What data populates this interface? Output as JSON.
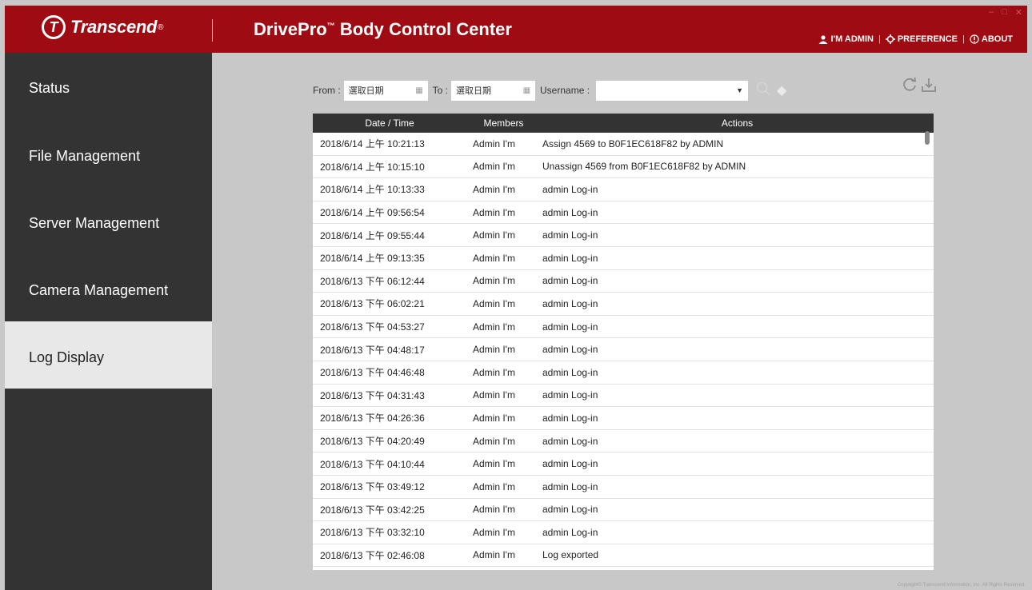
{
  "header": {
    "logo_text": "Transcend",
    "app_title": "DrivePro",
    "app_title_tm": "™",
    "app_title_rest": "Body Control Center",
    "links": {
      "user": "I'M ADMIN",
      "preference": "PREFERENCE",
      "about": "ABOUT"
    }
  },
  "sidebar": {
    "items": [
      {
        "label": "Status"
      },
      {
        "label": "File Management"
      },
      {
        "label": "Server Management"
      },
      {
        "label": "Camera Management"
      },
      {
        "label": "Log Display"
      }
    ]
  },
  "filters": {
    "from_label": "From :",
    "from_value": "選取日期",
    "to_label": "To :",
    "to_value": "選取日期",
    "username_label": "Username :",
    "username_value": ""
  },
  "table": {
    "headers": [
      "Date / Time",
      "Members",
      "Actions"
    ],
    "rows": [
      [
        "2018/6/14 上午 10:21:13",
        "Admin I'm",
        "Assign 4569 to B0F1EC618F82 by ADMIN"
      ],
      [
        "2018/6/14 上午 10:15:10",
        "Admin I'm",
        "Unassign 4569 from B0F1EC618F82 by ADMIN"
      ],
      [
        "2018/6/14 上午 10:13:33",
        "Admin I'm",
        "admin Log-in"
      ],
      [
        "2018/6/14 上午 09:56:54",
        "Admin I'm",
        "admin Log-in"
      ],
      [
        "2018/6/14 上午 09:55:44",
        "Admin I'm",
        "admin Log-in"
      ],
      [
        "2018/6/14 上午 09:13:35",
        "Admin I'm",
        "admin Log-in"
      ],
      [
        "2018/6/13 下午 06:12:44",
        "Admin I'm",
        "admin Log-in"
      ],
      [
        "2018/6/13 下午 06:02:21",
        "Admin I'm",
        "admin Log-in"
      ],
      [
        "2018/6/13 下午 04:53:27",
        "Admin I'm",
        "admin Log-in"
      ],
      [
        "2018/6/13 下午 04:48:17",
        "Admin I'm",
        "admin Log-in"
      ],
      [
        "2018/6/13 下午 04:46:48",
        "Admin I'm",
        "admin Log-in"
      ],
      [
        "2018/6/13 下午 04:31:43",
        "Admin I'm",
        "admin Log-in"
      ],
      [
        "2018/6/13 下午 04:26:36",
        "Admin I'm",
        "admin Log-in"
      ],
      [
        "2018/6/13 下午 04:20:49",
        "Admin I'm",
        "admin Log-in"
      ],
      [
        "2018/6/13 下午 04:10:44",
        "Admin I'm",
        "admin Log-in"
      ],
      [
        "2018/6/13 下午 03:49:12",
        "Admin I'm",
        "admin Log-in"
      ],
      [
        "2018/6/13 下午 03:42:25",
        "Admin I'm",
        "admin Log-in"
      ],
      [
        "2018/6/13 下午 03:32:10",
        "Admin I'm",
        "admin Log-in"
      ],
      [
        "2018/6/13 下午 02:46:08",
        "Admin I'm",
        "Log exported"
      ]
    ]
  },
  "footer": {
    "copyright": "Copyright© Transcend Information, Inc. All Rights Reserved."
  },
  "colors": {
    "brand": "#9e0b12",
    "sidebar": "#333333",
    "content_bg": "#c8c8c8"
  }
}
